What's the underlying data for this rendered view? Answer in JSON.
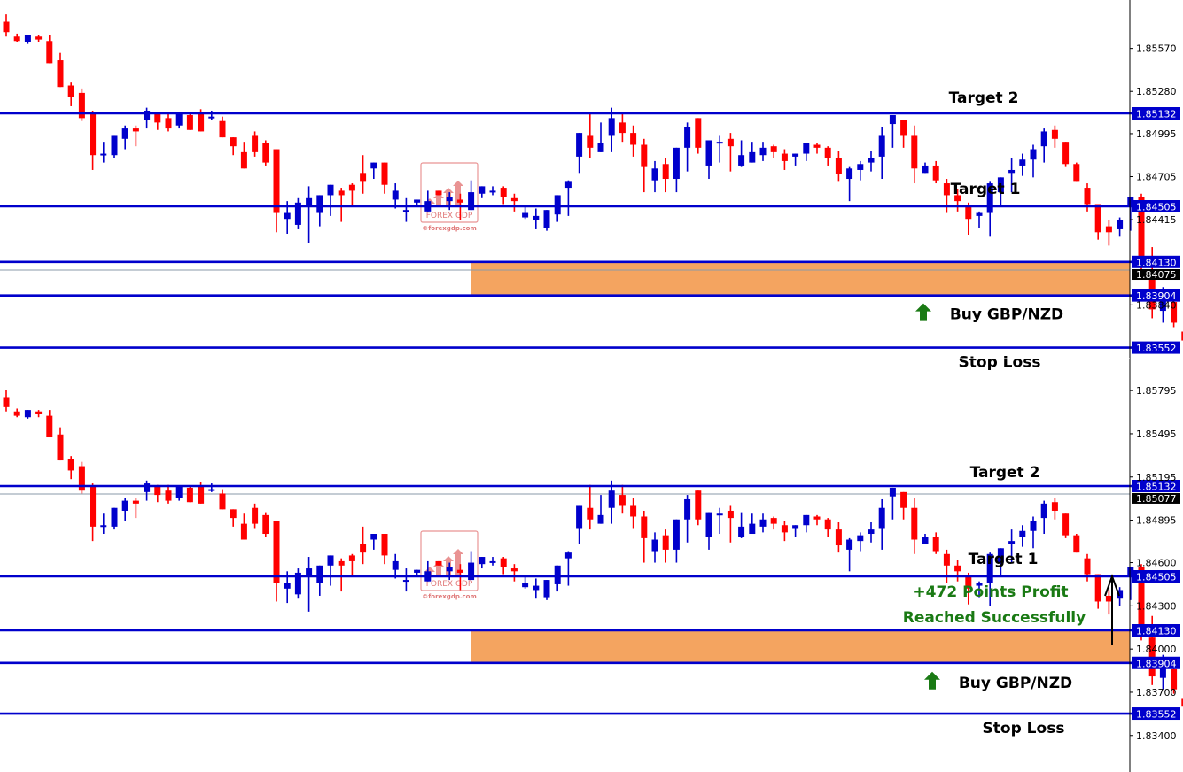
{
  "chart_data": [
    {
      "type": "candlestick",
      "panel": "top",
      "symbol": "GBP/NZD",
      "colors": {
        "bull": "#0000cc",
        "bear": "#ff0000",
        "level_line": "#0000cc",
        "zone": "#f4a460",
        "tag_bg": "#0000cc",
        "current_tag_bg": "#000000"
      },
      "y_ticks": [
        "1.85570",
        "1.85280",
        "1.84995",
        "1.84705",
        "1.84415",
        "1.83840"
      ],
      "levels": [
        {
          "name": "target-2",
          "price": "1.85132",
          "label": "Target 2"
        },
        {
          "name": "target-1",
          "price": "1.84505",
          "label": "Target 1"
        },
        {
          "name": "zone-top",
          "price": "1.84130",
          "label": ""
        },
        {
          "name": "zone-bottom",
          "price": "1.83904",
          "label": "Buy GBP/NZD"
        },
        {
          "name": "stop-loss",
          "price": "1.83552",
          "label": "Stop Loss"
        }
      ],
      "current_price": "1.84075",
      "buy_zone": {
        "from": "1.83904",
        "to": "1.84130"
      },
      "candles": [
        [
          1.8575,
          1.858,
          1.8568,
          1.8565
        ],
        [
          1.8565,
          1.8567,
          1.8562,
          1.8561
        ],
        [
          1.8561,
          1.8563,
          1.8566,
          1.856
        ],
        [
          1.8565,
          1.8566,
          1.8563,
          1.8561
        ],
        [
          1.8562,
          1.8566,
          1.8547,
          1.8547
        ],
        [
          1.8549,
          1.8554,
          1.8531,
          1.8532
        ],
        [
          1.8532,
          1.8534,
          1.8524,
          1.8518
        ],
        [
          1.8527,
          1.853,
          1.851,
          1.8508
        ],
        [
          1.8513,
          1.8515,
          1.8485,
          1.8475
        ],
        [
          1.8485,
          1.8494,
          1.8486,
          1.848
        ],
        [
          1.8485,
          1.8491,
          1.8498,
          1.8483
        ],
        [
          1.8496,
          1.8505,
          1.8503,
          1.8489
        ],
        [
          1.8503,
          1.8505,
          1.8501,
          1.8491
        ],
        [
          1.8509,
          1.8517,
          1.8515,
          1.8503
        ],
        [
          1.8513,
          1.8514,
          1.8507,
          1.8502
        ],
        [
          1.851,
          1.8514,
          1.8503,
          1.8501
        ],
        [
          1.8505,
          1.851,
          1.8513,
          1.8503
        ],
        [
          1.8512,
          1.8513,
          1.8502,
          1.8506
        ],
        [
          1.8513,
          1.8516,
          1.8501,
          1.8506
        ],
        [
          1.851,
          1.8515,
          1.8511,
          1.8509
        ],
        [
          1.8508,
          1.8511,
          1.8497,
          1.8497
        ],
        [
          1.8497,
          1.8497,
          1.8491,
          1.8485
        ],
        [
          1.8487,
          1.8494,
          1.8476,
          1.8484
        ],
        [
          1.8498,
          1.8501,
          1.8487,
          1.8484
        ],
        [
          1.8493,
          1.8495,
          1.848,
          1.8478
        ],
        [
          1.8489,
          1.8485,
          1.8446,
          1.8433
        ],
        [
          1.8442,
          1.8454,
          1.8446,
          1.8432
        ],
        [
          1.8438,
          1.8456,
          1.8453,
          1.8435
        ],
        [
          1.8451,
          1.8464,
          1.8456,
          1.8426
        ],
        [
          1.8446,
          1.8455,
          1.8458,
          1.8437
        ],
        [
          1.8458,
          1.8465,
          1.8465,
          1.8444
        ],
        [
          1.8461,
          1.8463,
          1.8458,
          1.844
        ],
        [
          1.8465,
          1.8466,
          1.8461,
          1.8451
        ],
        [
          1.8473,
          1.8485,
          1.8467,
          1.8459
        ],
        [
          1.8476,
          1.8476,
          1.848,
          1.8469
        ],
        [
          1.848,
          1.8474,
          1.8465,
          1.8459
        ],
        [
          1.8455,
          1.8466,
          1.8461,
          1.8449
        ],
        [
          1.8448,
          1.8456,
          1.8448,
          1.844
        ],
        [
          1.8453,
          1.8455,
          1.8455,
          1.845
        ],
        [
          1.8447,
          1.8461,
          1.8454,
          1.8447
        ],
        [
          1.8461,
          1.8461,
          1.8458,
          1.8458
        ],
        [
          1.8454,
          1.846,
          1.8457,
          1.8448
        ],
        [
          1.8455,
          1.8459,
          1.8453,
          1.8441
        ],
        [
          1.8448,
          1.8468,
          1.846,
          1.8455
        ],
        [
          1.8459,
          1.8463,
          1.8464,
          1.8456
        ],
        [
          1.8461,
          1.8464,
          1.8461,
          1.8458
        ],
        [
          1.8463,
          1.8464,
          1.8457,
          1.8452
        ],
        [
          1.8456,
          1.8459,
          1.8454,
          1.8447
        ],
        [
          1.8443,
          1.8451,
          1.8446,
          1.8442
        ],
        [
          1.8441,
          1.8449,
          1.8444,
          1.8435
        ],
        [
          1.8436,
          1.8446,
          1.8448,
          1.8434
        ],
        [
          1.8445,
          1.8455,
          1.8458,
          1.844
        ],
        [
          1.8463,
          1.8468,
          1.8467,
          1.8444
        ],
        [
          1.8484,
          1.849,
          1.85,
          1.8473
        ],
        [
          1.8498,
          1.8514,
          1.849,
          1.8483
        ],
        [
          1.8487,
          1.8507,
          1.8493,
          1.8488
        ],
        [
          1.8498,
          1.8517,
          1.851,
          1.8487
        ],
        [
          1.8507,
          1.8514,
          1.85,
          1.8494
        ],
        [
          1.85,
          1.8505,
          1.8492,
          1.8484
        ],
        [
          1.8492,
          1.8496,
          1.8477,
          1.846
        ],
        [
          1.8468,
          1.8481,
          1.8476,
          1.846
        ],
        [
          1.8479,
          1.8483,
          1.8469,
          1.846
        ],
        [
          1.8469,
          1.8484,
          1.849,
          1.846
        ],
        [
          1.849,
          1.8507,
          1.8504,
          1.8474
        ],
        [
          1.851,
          1.851,
          1.849,
          1.8486
        ],
        [
          1.8478,
          1.8493,
          1.8495,
          1.8469
        ],
        [
          1.8494,
          1.8498,
          1.8494,
          1.848
        ],
        [
          1.8496,
          1.85,
          1.8491,
          1.8474
        ],
        [
          1.8478,
          1.8495,
          1.8485,
          1.8477
        ],
        [
          1.848,
          1.8494,
          1.8487,
          1.8482
        ],
        [
          1.8485,
          1.8494,
          1.849,
          1.8481
        ],
        [
          1.8491,
          1.8492,
          1.8487,
          1.8483
        ],
        [
          1.8486,
          1.8489,
          1.8481,
          1.8475
        ],
        [
          1.8484,
          1.8485,
          1.8486,
          1.8478
        ],
        [
          1.8486,
          1.849,
          1.8493,
          1.8481
        ],
        [
          1.8492,
          1.8493,
          1.849,
          1.8486
        ],
        [
          1.849,
          1.8491,
          1.8483,
          1.8478
        ],
        [
          1.8483,
          1.8488,
          1.8472,
          1.8467
        ],
        [
          1.8469,
          1.8477,
          1.8476,
          1.8454
        ],
        [
          1.8475,
          1.8481,
          1.8479,
          1.8468
        ],
        [
          1.848,
          1.8488,
          1.8483,
          1.8474
        ],
        [
          1.8484,
          1.8504,
          1.8498,
          1.8469
        ],
        [
          1.8506,
          1.851,
          1.8512,
          1.849
        ],
        [
          1.8509,
          1.8507,
          1.8498,
          1.849
        ],
        [
          1.8498,
          1.8505,
          1.8476,
          1.8466
        ],
        [
          1.8473,
          1.848,
          1.8478,
          1.8473
        ],
        [
          1.8478,
          1.8481,
          1.8468,
          1.8466
        ],
        [
          1.8466,
          1.8469,
          1.8458,
          1.8446
        ],
        [
          1.8458,
          1.8462,
          1.8454,
          1.8447
        ],
        [
          1.845,
          1.8453,
          1.8442,
          1.8431
        ],
        [
          1.8444,
          1.8447,
          1.8446,
          1.8436
        ],
        [
          1.8446,
          1.8467,
          1.8466,
          1.843
        ],
        [
          1.846,
          1.846,
          1.847,
          1.845
        ],
        [
          1.8473,
          1.8483,
          1.8475,
          1.846
        ],
        [
          1.8478,
          1.8486,
          1.8482,
          1.8471
        ],
        [
          1.8482,
          1.8492,
          1.8489,
          1.847
        ],
        [
          1.8491,
          1.8503,
          1.8501,
          1.848
        ],
        [
          1.8502,
          1.8505,
          1.8496,
          1.849
        ],
        [
          1.8494,
          1.8494,
          1.8479,
          1.8477
        ],
        [
          1.8479,
          1.848,
          1.8467,
          1.8467
        ],
        [
          1.8463,
          1.8466,
          1.8452,
          1.8447
        ],
        [
          1.8452,
          1.8451,
          1.8433,
          1.8428
        ],
        [
          1.8437,
          1.8441,
          1.8433,
          1.8424
        ],
        [
          1.8435,
          1.8443,
          1.8441,
          1.843
        ],
        [
          1.845,
          1.8456,
          1.8457,
          1.8434
        ],
        [
          1.8457,
          1.8459,
          1.8411,
          1.8406
        ],
        [
          1.8408,
          1.8423,
          1.8381,
          1.8375
        ],
        [
          1.838,
          1.8396,
          1.839,
          1.8372
        ],
        [
          1.8386,
          1.8394,
          1.8372,
          1.8369
        ],
        [
          1.8366,
          1.837,
          1.836,
          1.8357
        ],
        [
          1.836,
          1.837,
          1.8367,
          1.8358
        ],
        [
          1.837,
          1.8408,
          1.8406,
          1.8367
        ],
        [
          1.8406,
          1.8418,
          1.8406,
          1.8401
        ]
      ]
    },
    {
      "type": "candlestick",
      "panel": "bottom",
      "symbol": "GBP/NZD",
      "colors": {
        "bull": "#0000cc",
        "bear": "#ff0000",
        "level_line": "#0000cc",
        "zone": "#f4a460",
        "tag_bg": "#0000cc",
        "current_tag_bg": "#000000"
      },
      "y_ticks": [
        "1.85795",
        "1.85495",
        "1.85195",
        "1.84895",
        "1.84600",
        "1.84300",
        "1.84000",
        "1.83700",
        "1.83400"
      ],
      "levels": [
        {
          "name": "target-2",
          "price": "1.85132",
          "label": "Target 2"
        },
        {
          "name": "target-1",
          "price": "1.84505",
          "label": "Target 1"
        },
        {
          "name": "zone-top",
          "price": "1.84130",
          "label": ""
        },
        {
          "name": "zone-bottom",
          "price": "1.83904",
          "label": "Buy GBP/NZD"
        },
        {
          "name": "stop-loss",
          "price": "1.83552",
          "label": "Stop Loss"
        }
      ],
      "current_price": "1.85077",
      "buy_zone": {
        "from": "1.83904",
        "to": "1.84130"
      },
      "annotation": {
        "line1": "+472 Points Profit",
        "line2": "Reached Successfully",
        "arrow": "up"
      }
    }
  ],
  "watermark": {
    "brand": "FOREX GDP",
    "url": "©forexgdp.com"
  }
}
